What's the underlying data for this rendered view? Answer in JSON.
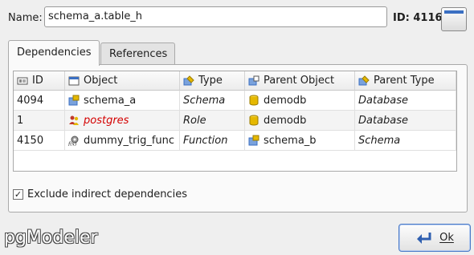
{
  "name_label": "Name:",
  "name_value": "schema_a.table_h",
  "id_label": "ID: 4116",
  "tabs": [
    "Dependencies",
    "References"
  ],
  "table": {
    "headers": [
      "ID",
      "Object",
      "Type",
      "Parent Object",
      "Parent Type"
    ],
    "rows": [
      [
        "4094",
        "schema_a",
        "Schema",
        "demodb",
        "Database"
      ],
      [
        "1",
        "postgres",
        "Role",
        "demodb",
        "Database"
      ],
      [
        "4150",
        "dummy_trig_func",
        "Function",
        "schema_b",
        "Schema"
      ]
    ]
  },
  "exclude_label": "Exclude indirect dependencies",
  "exclude_checked": "✓",
  "logo": "pgModeler",
  "ok_label": "Ok",
  "colors": {
    "role_text": "#d40000",
    "schema_icon": "#3b6fc2",
    "database_icon": "#e5b800"
  }
}
